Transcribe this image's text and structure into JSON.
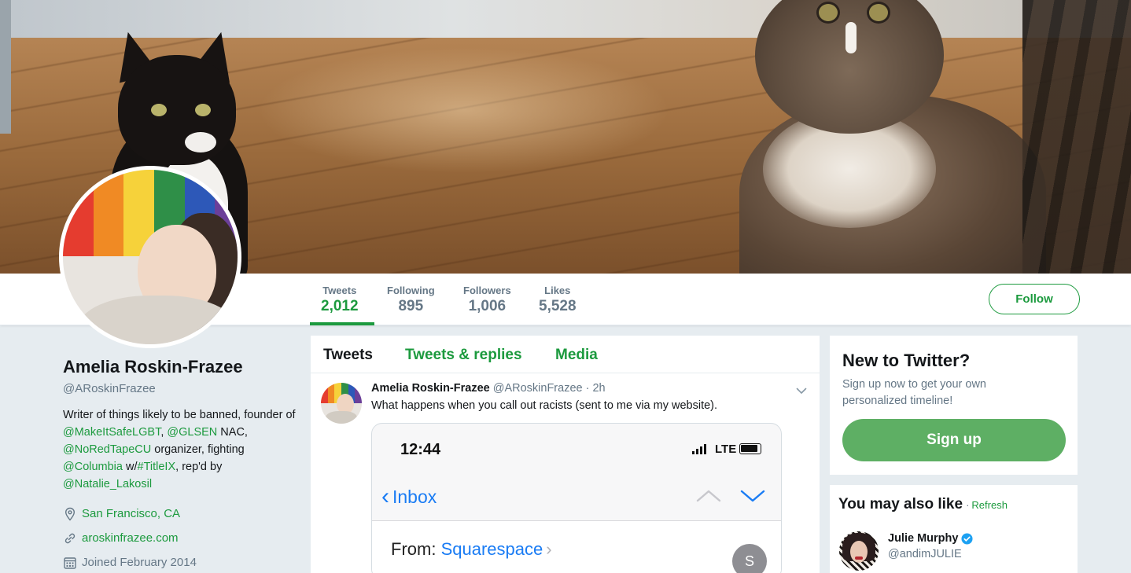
{
  "profile": {
    "name": "Amelia Roskin-Frazee",
    "handle": "@ARoskinFrazee",
    "bio": [
      {
        "t": "Writer of things likely to be banned, founder of ",
        "link": false
      },
      {
        "t": "@MakeItSafeLGBT",
        "link": true
      },
      {
        "t": ", ",
        "link": false
      },
      {
        "t": "@GLSEN",
        "link": true
      },
      {
        "t": " NAC, ",
        "link": false
      },
      {
        "t": "@NoRedTapeCU",
        "link": true
      },
      {
        "t": " organizer, fighting ",
        "link": false
      },
      {
        "t": "@Columbia",
        "link": true
      },
      {
        "t": " w/",
        "link": false
      },
      {
        "t": "#TitleIX",
        "link": true
      },
      {
        "t": ", rep'd by ",
        "link": false
      },
      {
        "t": "@Natalie_Lakosil",
        "link": true
      }
    ],
    "location": "San Francisco, CA",
    "website": "aroskinfrazee.com",
    "joined": "Joined February 2014"
  },
  "stats": [
    {
      "label": "Tweets",
      "value": "2,012",
      "active": true
    },
    {
      "label": "Following",
      "value": "895",
      "active": false
    },
    {
      "label": "Followers",
      "value": "1,006",
      "active": false
    },
    {
      "label": "Likes",
      "value": "5,528",
      "active": false
    }
  ],
  "follow_label": "Follow",
  "timeline": {
    "tabs": [
      "Tweets",
      "Tweets & replies",
      "Media"
    ],
    "tweet": {
      "name": "Amelia Roskin-Frazee",
      "handle": "@ARoskinFrazee",
      "time": "· 2h",
      "text": "What happens when you call out racists (sent to me via my website).",
      "phone": {
        "time": "12:44",
        "network": "LTE",
        "back_label": "Inbox",
        "from_label": "From:",
        "sender": "Squarespace",
        "sender_initial": "S"
      }
    }
  },
  "signup": {
    "title": "New to Twitter?",
    "subtitle": "Sign up now to get your own personalized timeline!",
    "button": "Sign up"
  },
  "suggestions": {
    "title": "You may also like",
    "separator": "·",
    "refresh": "Refresh",
    "users": [
      {
        "name": "Julie Murphy",
        "handle": "@andimJULIE",
        "verified": true
      }
    ]
  },
  "colors": {
    "accent": "#1c9a3e",
    "signup_button": "#5eaf64",
    "link_blue": "#1a7cf4",
    "verified": "#1da1f2"
  },
  "icons": [
    "location-pin-icon",
    "link-icon",
    "calendar-icon",
    "chevron-down-icon",
    "verified-badge-icon",
    "signal-bars-icon",
    "battery-icon"
  ]
}
